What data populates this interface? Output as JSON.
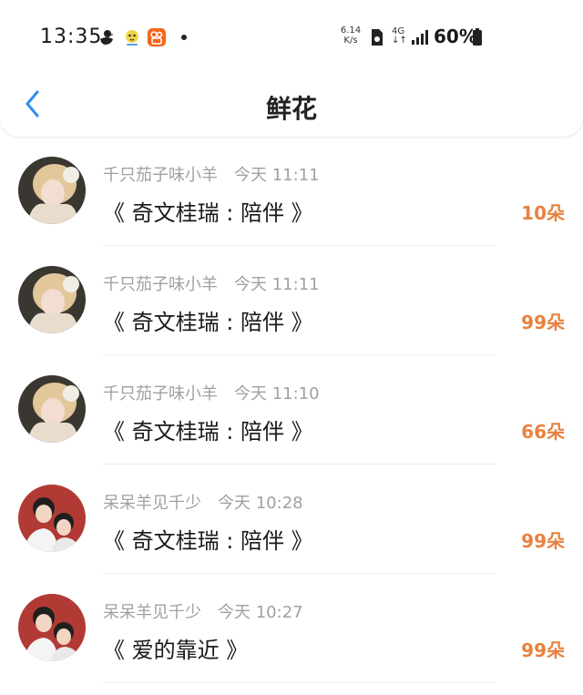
{
  "status_bar": {
    "time": "13:35",
    "speed_value": "6.14",
    "speed_unit": "K/s",
    "network": "4G",
    "battery": "60%"
  },
  "header": {
    "title": "鲜花",
    "back_icon": "chevron-left-icon"
  },
  "colors": {
    "accent_blue": "#2e8ef0",
    "count_orange": "#e8823f",
    "meta_gray": "#a0a0a0"
  },
  "gifts": [
    {
      "user": "千只茄子味小羊",
      "time": "今天 11:11",
      "work": "《 奇文桂瑞 : 陪伴 》",
      "count": "10朵"
    },
    {
      "user": "千只茄子味小羊",
      "time": "今天 11:11",
      "work": "《 奇文桂瑞 : 陪伴 》",
      "count": "99朵"
    },
    {
      "user": "千只茄子味小羊",
      "time": "今天 11:10",
      "work": "《 奇文桂瑞 : 陪伴 》",
      "count": "66朵"
    },
    {
      "user": "呆呆羊见千少",
      "time": "今天 10:28",
      "work": "《 奇文桂瑞 : 陪伴 》",
      "count": "99朵"
    },
    {
      "user": "呆呆羊见千少",
      "time": "今天 10:27",
      "work": "《 爱的靠近 》",
      "count": "99朵"
    }
  ]
}
